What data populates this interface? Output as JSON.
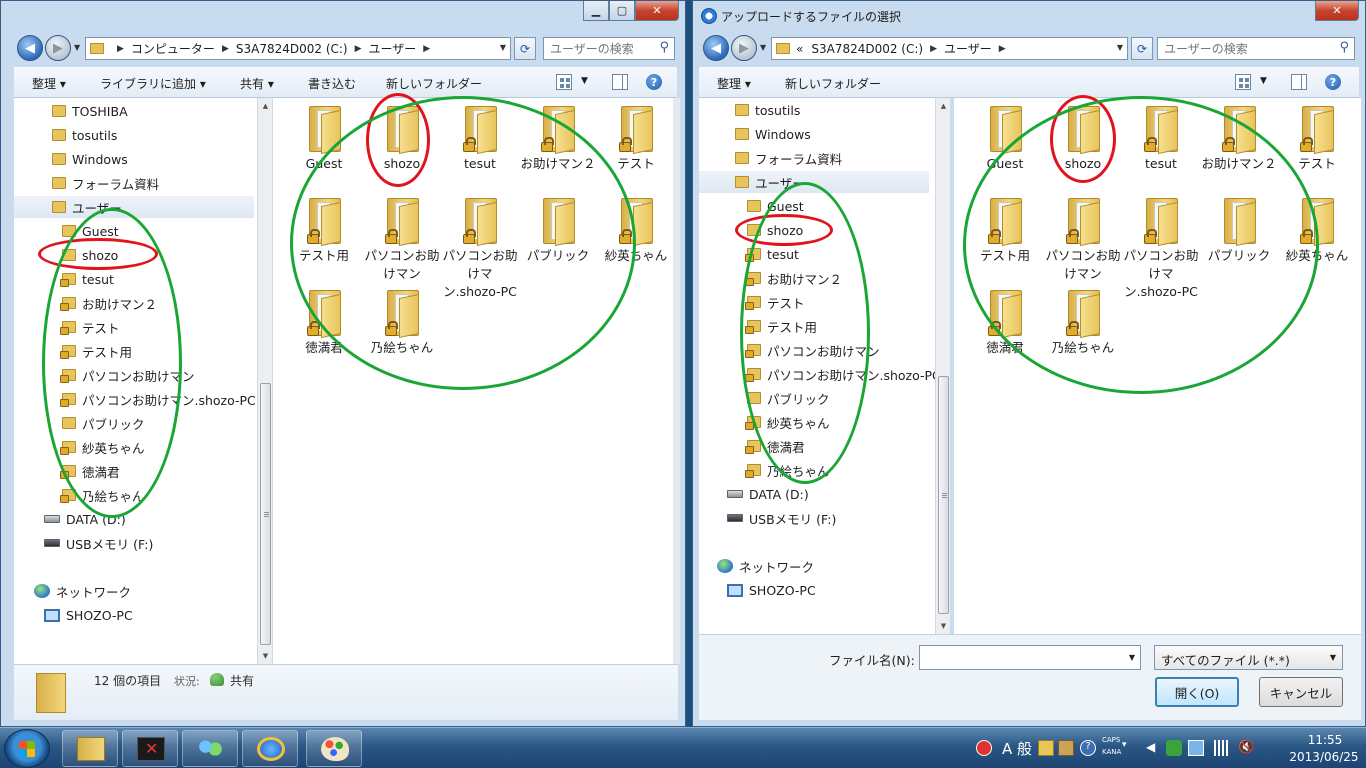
{
  "left_window": {
    "breadcrumbs": [
      "コンピューター",
      "S3A7824D002 (C:)",
      "ユーザー"
    ],
    "search_placeholder": "ユーザーの検索",
    "toolbar": [
      "整理",
      "ライブラリに追加",
      "共有",
      "書き込む",
      "新しいフォルダー"
    ],
    "tree": [
      {
        "label": "TOSHIBA",
        "icon": "folder-icon"
      },
      {
        "label": "tosutils",
        "icon": "folder-icon"
      },
      {
        "label": "Windows",
        "icon": "folder-icon"
      },
      {
        "label": "フォーラム資料",
        "icon": "folder-icon"
      },
      {
        "label": "ユーザー",
        "icon": "folder-icon",
        "selected": true
      },
      {
        "label": "Guest",
        "icon": "folder-icon"
      },
      {
        "label": "shozo",
        "icon": "folder-icon"
      },
      {
        "label": "tesut",
        "icon": "locked-folder-icon"
      },
      {
        "label": "お助けマン２",
        "icon": "locked-folder-icon"
      },
      {
        "label": "テスト",
        "icon": "locked-folder-icon"
      },
      {
        "label": "テスト用",
        "icon": "locked-folder-icon"
      },
      {
        "label": "パソコンお助けマン",
        "icon": "locked-folder-icon"
      },
      {
        "label": "パソコンお助けマン.shozo-PC",
        "icon": "locked-folder-icon"
      },
      {
        "label": "パブリック",
        "icon": "folder-icon"
      },
      {
        "label": "紗英ちゃん",
        "icon": "locked-folder-icon"
      },
      {
        "label": "徳満君",
        "icon": "locked-folder-icon"
      },
      {
        "label": "乃絵ちゃん",
        "icon": "locked-folder-icon"
      },
      {
        "label": "DATA (D:)",
        "icon": "drive-icon"
      },
      {
        "label": "USBメモリ (F:)",
        "icon": "usb-drive-icon"
      },
      {
        "label": "ネットワーク",
        "icon": "network-icon"
      },
      {
        "label": "SHOZO-PC",
        "icon": "computer-icon"
      }
    ],
    "files": [
      {
        "label": "Guest",
        "locked": false
      },
      {
        "label": "shozo",
        "locked": false
      },
      {
        "label": "tesut",
        "locked": true
      },
      {
        "label": "お助けマン２",
        "locked": true
      },
      {
        "label": "テスト",
        "locked": true
      },
      {
        "label": "テスト用",
        "locked": true
      },
      {
        "label": "パソコンお助けマン",
        "locked": true
      },
      {
        "label": "パソコンお助けマン.shozo-PC",
        "locked": true
      },
      {
        "label": "パブリック",
        "locked": false
      },
      {
        "label": "紗英ちゃん",
        "locked": true
      },
      {
        "label": "徳満君",
        "locked": true
      },
      {
        "label": "乃絵ちゃん",
        "locked": true
      }
    ],
    "details": {
      "count": "12 個の項目",
      "state_label": "状況:",
      "share": "共有"
    }
  },
  "right_window": {
    "title": "アップロードするファイルの選択",
    "breadcrumbs": [
      "«",
      "S3A7824D002 (C:)",
      "ユーザー"
    ],
    "search_placeholder": "ユーザーの検索",
    "toolbar": [
      "整理",
      "新しいフォルダー"
    ],
    "tree": [
      {
        "label": "tosutils",
        "icon": "folder-icon"
      },
      {
        "label": "Windows",
        "icon": "folder-icon"
      },
      {
        "label": "フォーラム資料",
        "icon": "folder-icon"
      },
      {
        "label": "ユーザー",
        "icon": "folder-icon",
        "selected": true
      },
      {
        "label": "Guest",
        "icon": "folder-icon"
      },
      {
        "label": "shozo",
        "icon": "folder-icon"
      },
      {
        "label": "tesut",
        "icon": "locked-folder-icon"
      },
      {
        "label": "お助けマン２",
        "icon": "locked-folder-icon"
      },
      {
        "label": "テスト",
        "icon": "locked-folder-icon"
      },
      {
        "label": "テスト用",
        "icon": "locked-folder-icon"
      },
      {
        "label": "パソコンお助けマン",
        "icon": "locked-folder-icon"
      },
      {
        "label": "パソコンお助けマン.shozo-PC",
        "icon": "locked-folder-icon"
      },
      {
        "label": "パブリック",
        "icon": "folder-icon"
      },
      {
        "label": "紗英ちゃん",
        "icon": "locked-folder-icon"
      },
      {
        "label": "徳満君",
        "icon": "locked-folder-icon"
      },
      {
        "label": "乃絵ちゃん",
        "icon": "locked-folder-icon"
      },
      {
        "label": "DATA (D:)",
        "icon": "drive-icon"
      },
      {
        "label": "USBメモリ (F:)",
        "icon": "usb-drive-icon"
      },
      {
        "label": "ネットワーク",
        "icon": "network-icon"
      },
      {
        "label": "SHOZO-PC",
        "icon": "computer-icon"
      }
    ],
    "files": [
      {
        "label": "Guest",
        "locked": false
      },
      {
        "label": "shozo",
        "locked": false
      },
      {
        "label": "tesut",
        "locked": true
      },
      {
        "label": "お助けマン２",
        "locked": true
      },
      {
        "label": "テスト",
        "locked": true
      },
      {
        "label": "テスト用",
        "locked": true
      },
      {
        "label": "パソコンお助けマン",
        "locked": true
      },
      {
        "label": "パソコンお助けマン.shozo-PC",
        "locked": true
      },
      {
        "label": "パブリック",
        "locked": false
      },
      {
        "label": "紗英ちゃん",
        "locked": true
      },
      {
        "label": "徳満君",
        "locked": true
      },
      {
        "label": "乃絵ちゃん",
        "locked": true
      }
    ],
    "dialog": {
      "filename_label": "ファイル名(N):",
      "filename_value": "",
      "filetype": "すべてのファイル (*.*)",
      "open": "開く(O)",
      "cancel": "キャンセル"
    }
  },
  "taskbar": {
    "apps": [
      "explorer-icon",
      "app-icon",
      "people-icon",
      "internet-explorer-icon",
      "paint-icon"
    ],
    "ime": "A 般",
    "caps": "CAPS",
    "kana": "KANA",
    "time": "11:55",
    "date": "2013/06/25"
  },
  "colors": {
    "red_mark": "#e0141c",
    "green_mark": "#1aa634"
  }
}
